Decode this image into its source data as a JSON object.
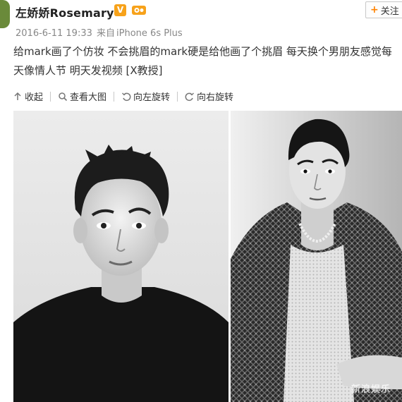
{
  "post": {
    "username": "左娇娇Rosemary",
    "verified_badge": "V",
    "follow_label": "关注",
    "follow_plus": "+",
    "timestamp": "2016-6-11 19:33",
    "source_prefix": "来自",
    "device": "iPhone 6s Plus",
    "text_line1": "给mark画了个仿妆 不会挑眉的mark硬是给他画了个挑眉 每天换个男朋友感觉每",
    "text_line2": "天像情人节 明天发视频 [X教授]"
  },
  "toolbar": {
    "collapse_label": "收起",
    "view_large_label": "查看大图",
    "rotate_left_label": "向左旋转",
    "rotate_right_label": "向右旋转"
  },
  "photos": {
    "watermark": "新浪娱乐"
  },
  "colors": {
    "accent": "#ff8200",
    "badge": "#f7a21a",
    "text": "#333333",
    "meta": "#888888"
  }
}
